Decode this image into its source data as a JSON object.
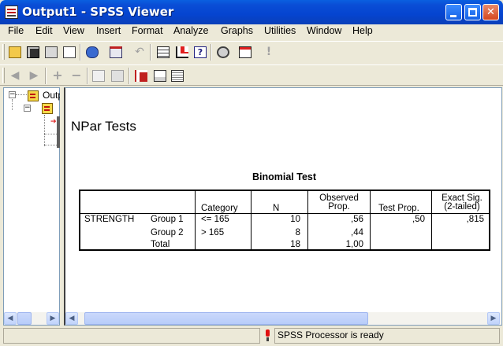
{
  "window": {
    "title": "Output1 - SPSS Viewer",
    "minimize_label": "_",
    "maximize_label": "□",
    "close_label": "✕"
  },
  "menu": [
    "File",
    "Edit",
    "View",
    "Insert",
    "Format",
    "Analyze",
    "Graphs",
    "Utilities",
    "Window",
    "Help"
  ],
  "toolbar1": [
    "open-icon",
    "save-icon",
    "print-icon",
    "print-preview-icon",
    "export-icon",
    "recall-dialog-icon",
    "undo-icon",
    "goto-data-icon",
    "goto-case-icon",
    "variables-icon",
    "use-sets-icon",
    "designate-window-icon",
    "help-icon"
  ],
  "toolbar2": [
    "back-icon",
    "forward-icon",
    "expand-icon",
    "collapse-icon",
    "show-icon",
    "hide-icon",
    "insert-heading-icon",
    "insert-title-icon",
    "insert-text-icon"
  ],
  "outline": {
    "root_label": "Outp",
    "expand_glyph": "−"
  },
  "output": {
    "heading": "NPar Tests",
    "table": {
      "title": "Binomial Test",
      "headers": {
        "category": "Category",
        "n": "N",
        "observed_prop_1": "Observed",
        "observed_prop_2": "Prop.",
        "test_prop": "Test Prop.",
        "exact_sig_1": "Exact Sig.",
        "exact_sig_2": "(2-tailed)"
      },
      "variable": "STRENGTH",
      "rows": [
        {
          "group": "Group 1",
          "category": "<= 165",
          "n": "10",
          "observed": ",56",
          "test_prop": ",50",
          "sig": ",815"
        },
        {
          "group": "Group 2",
          "category": "> 165",
          "n": "8",
          "observed": ",44",
          "test_prop": "",
          "sig": ""
        },
        {
          "group": "Total",
          "category": "",
          "n": "18",
          "observed": "1,00",
          "test_prop": "",
          "sig": ""
        }
      ]
    }
  },
  "status": {
    "text": "SPSS Processor  is ready"
  },
  "colors": {
    "titlebar": "#0a4ed6",
    "window_bg": "#ece9d8",
    "status_icon": "#e01010"
  }
}
